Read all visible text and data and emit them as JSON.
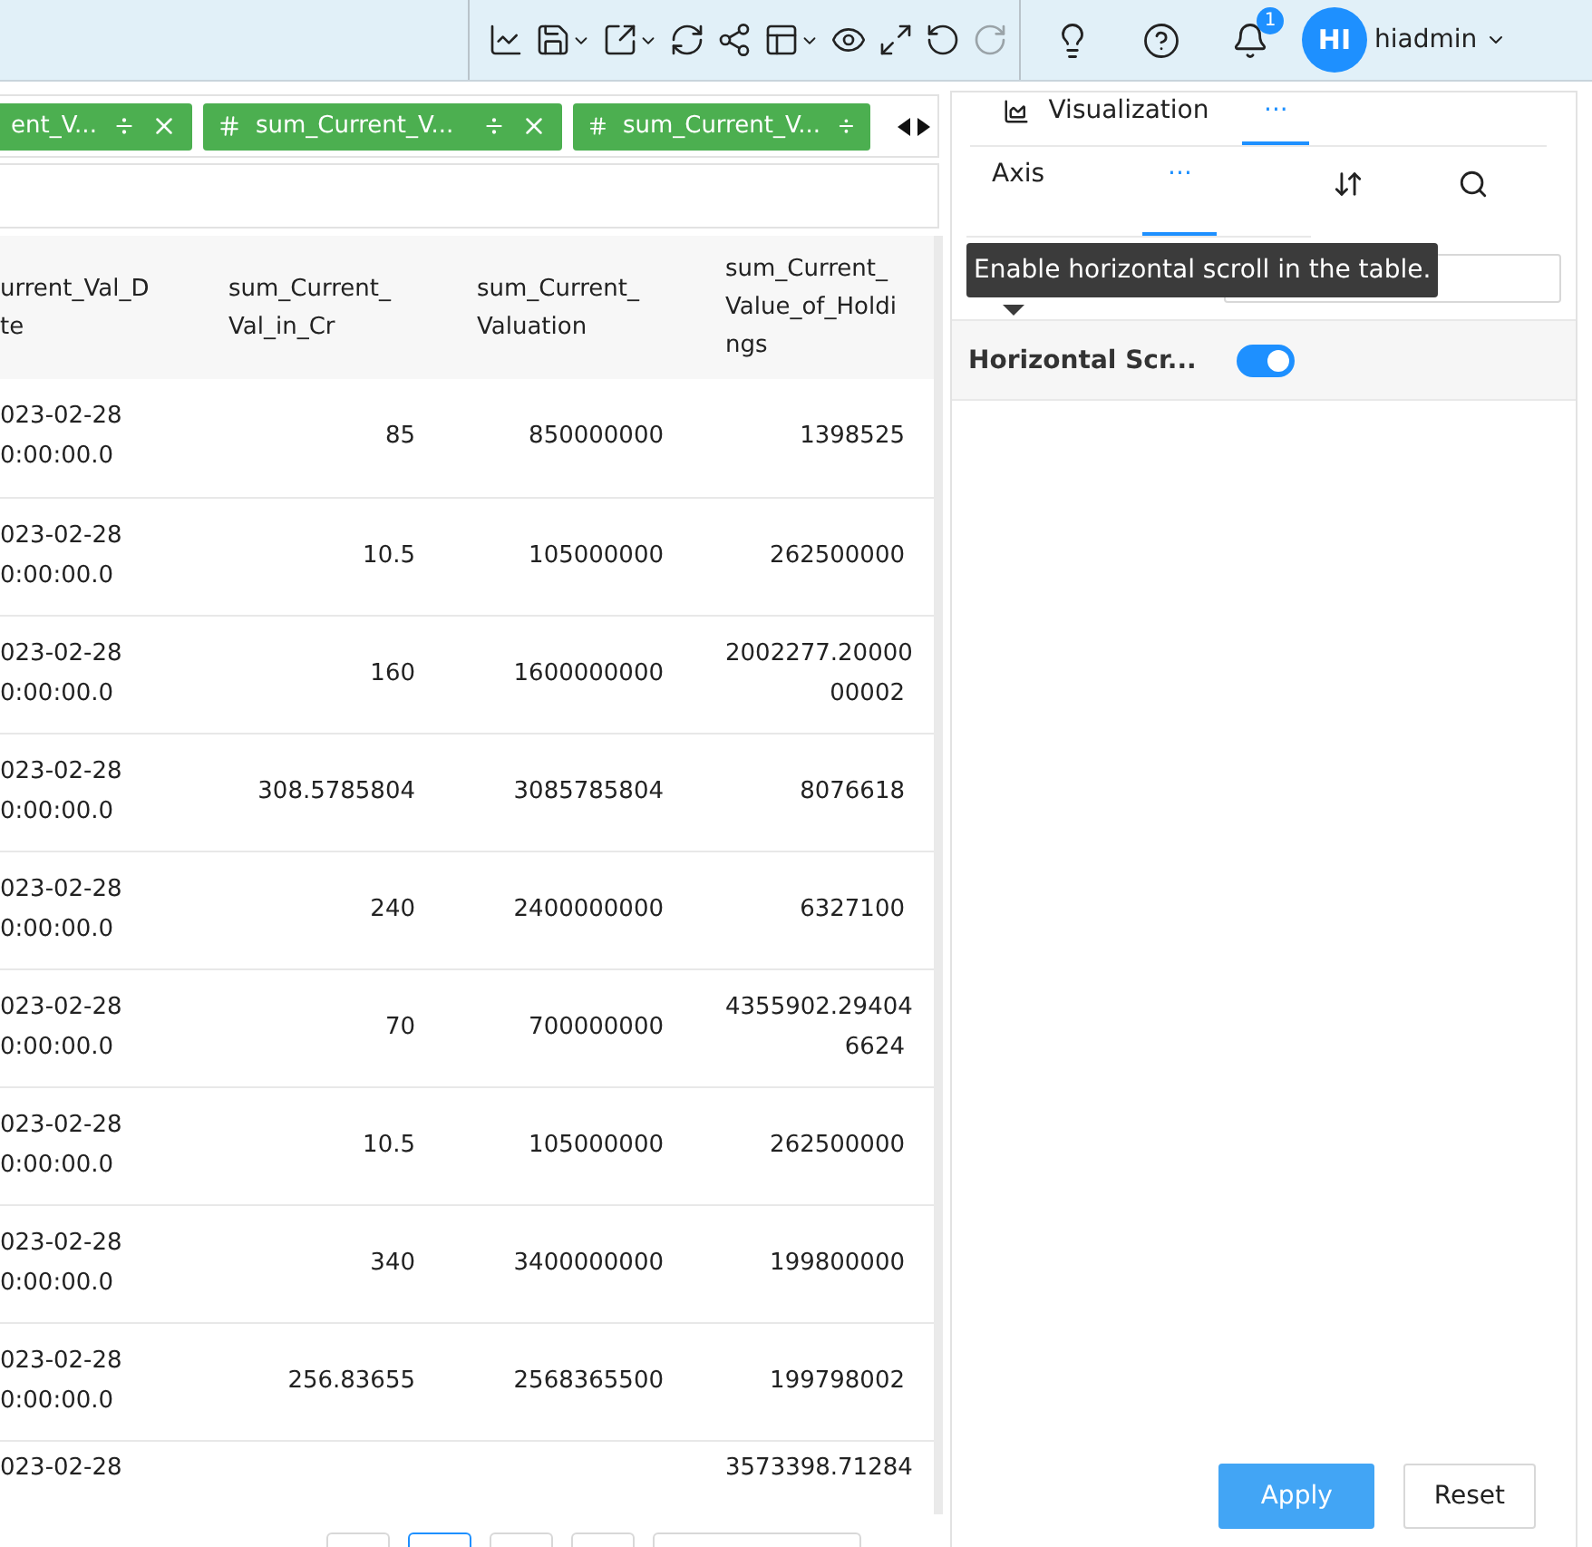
{
  "toolbar": {
    "tools": [
      {
        "kind": "line-chart",
        "caret": false,
        "disabled": false
      },
      {
        "kind": "save",
        "caret": true,
        "disabled": false
      },
      {
        "kind": "export",
        "caret": true,
        "disabled": false
      },
      {
        "kind": "refresh",
        "caret": false,
        "disabled": false
      },
      {
        "kind": "share",
        "caret": false,
        "disabled": false
      },
      {
        "kind": "layout",
        "caret": true,
        "disabled": false
      },
      {
        "kind": "preview",
        "caret": false,
        "disabled": false
      },
      {
        "kind": "expand",
        "caret": false,
        "disabled": false
      },
      {
        "kind": "undo",
        "caret": false,
        "disabled": false
      },
      {
        "kind": "redo",
        "caret": false,
        "disabled": true
      }
    ],
    "actions": [
      {
        "kind": "bulb"
      },
      {
        "kind": "help"
      },
      {
        "kind": "bell",
        "badge": "1"
      }
    ],
    "user": {
      "initials": "HI",
      "name": "hiadmin"
    }
  },
  "chips": [
    {
      "label": "ent_V...",
      "icon": false,
      "closable": true
    },
    {
      "label": "sum_Current_V...",
      "icon": true,
      "closable": true
    },
    {
      "label": "sum_Current_V...",
      "icon": true,
      "closable": false
    }
  ],
  "table": {
    "columns": [
      "urrent_Val_D\nte",
      "sum_Current_\nVal_in_Cr",
      "sum_Current_\nValuation",
      "sum_Current_\nValue_of_Holdi\nngs"
    ],
    "rows": [
      [
        "023-02-28\n0:00:00.0",
        "85",
        "850000000",
        "1398525"
      ],
      [
        "023-02-28\n0:00:00.0",
        "10.5",
        "105000000",
        "262500000"
      ],
      [
        "023-02-28\n0:00:00.0",
        "160",
        "1600000000",
        "2002277.20000\n00002"
      ],
      [
        "023-02-28\n0:00:00.0",
        "308.5785804",
        "3085785804",
        "8076618"
      ],
      [
        "023-02-28\n0:00:00.0",
        "240",
        "2400000000",
        "6327100"
      ],
      [
        "023-02-28\n0:00:00.0",
        "70",
        "700000000",
        "4355902.29404\n6624"
      ],
      [
        "023-02-28\n0:00:00.0",
        "10.5",
        "105000000",
        "262500000"
      ],
      [
        "023-02-28\n0:00:00.0",
        "340",
        "3400000000",
        "199800000"
      ],
      [
        "023-02-28\n0:00:00.0",
        "256.83655",
        "2568365500",
        "199798002"
      ],
      [
        "023-02-28",
        "",
        "",
        "3573398.71284"
      ]
    ]
  },
  "panel": {
    "tabs": [
      {
        "label": "Visualization",
        "kind": "chart",
        "selected": false
      },
      {
        "label": "···",
        "kind": "text",
        "selected": true
      }
    ],
    "subtabs": [
      {
        "label": "Axis",
        "kind": "text",
        "selected": false
      },
      {
        "label": "···",
        "kind": "text",
        "selected": true
      },
      {
        "kind": "sort",
        "selected": false
      },
      {
        "kind": "search",
        "selected": false
      }
    ],
    "tooltip": "Enable horizontal scroll in the table.",
    "setting": {
      "label": "Horizontal Scr...",
      "on": true
    },
    "buttons": [
      {
        "label": "Apply",
        "kind": "primary"
      },
      {
        "label": "Reset",
        "kind": "default"
      }
    ]
  }
}
